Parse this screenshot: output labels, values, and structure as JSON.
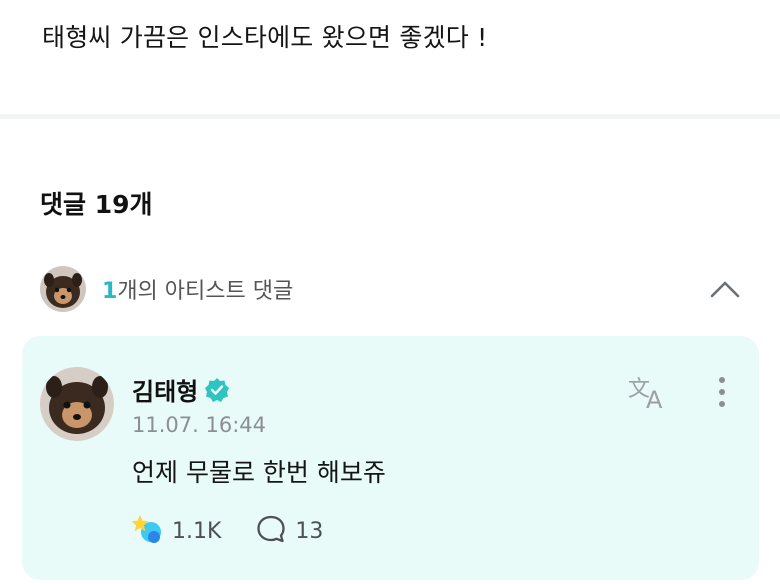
{
  "post": {
    "text": "태형씨 가끔은 인스타에도 왔으면 좋겠다 !"
  },
  "comments": {
    "header": "댓글 19개",
    "artist_section": {
      "count": "1",
      "label": "개의 아티스트 댓글"
    }
  },
  "artist_comment": {
    "author": "김태형",
    "timestamp": "11.07. 16:44",
    "body": "언제 무물로 한번 해보쥬",
    "likes": "1.1K",
    "replies": "13"
  },
  "icons": {
    "verified": "verified-badge-icon",
    "translate": "translate-icon",
    "more": "more-vertical-icon",
    "like": "cheer-icon",
    "reply": "speech-bubble-icon",
    "collapse": "chevron-up-icon"
  },
  "colors": {
    "accent": "#2ab8c6",
    "card_bg": "#e8fbf8",
    "timestamp": "#8a8f94"
  }
}
